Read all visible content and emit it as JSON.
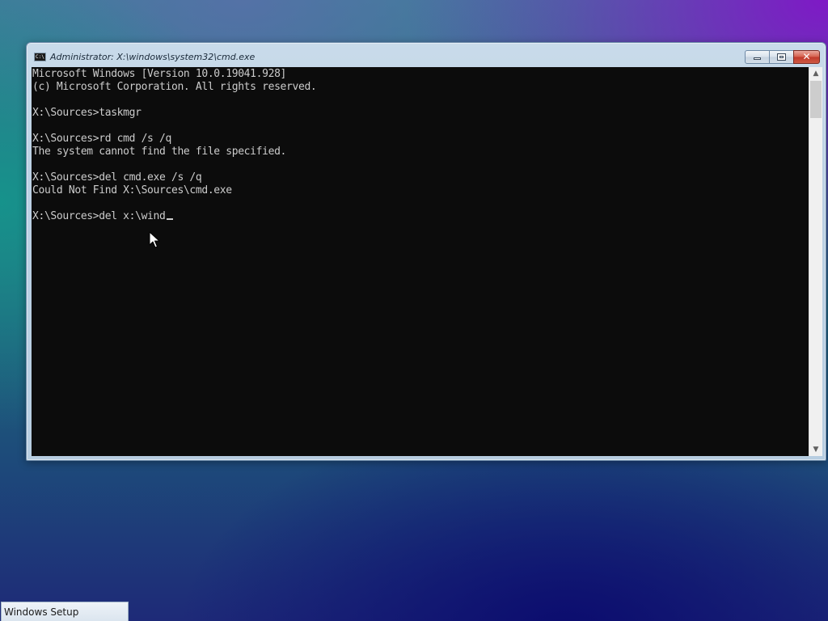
{
  "window": {
    "title": "Administrator: X:\\windows\\system32\\cmd.exe",
    "icon": "cmd-console-icon",
    "icon_label": "C:\\",
    "controls": {
      "minimize_icon": "minimize-icon",
      "maximize_icon": "restore-icon",
      "close_icon": "close-icon",
      "close_glyph": "✕"
    }
  },
  "console": {
    "lines": [
      "Microsoft Windows [Version 10.0.19041.928]",
      "(c) Microsoft Corporation. All rights reserved.",
      "",
      "X:\\Sources>taskmgr",
      "",
      "X:\\Sources>rd cmd /s /q",
      "The system cannot find the file specified.",
      "",
      "X:\\Sources>del cmd.exe /s /q",
      "Could Not Find X:\\Sources\\cmd.exe",
      "",
      "X:\\Sources>del x:\\wind"
    ],
    "colors": {
      "background": "#0c0c0c",
      "foreground": "#cccccc"
    }
  },
  "scrollbar": {
    "up_glyph": "▲",
    "down_glyph": "▼"
  },
  "taskbar": {
    "items": [
      {
        "label": "Windows Setup"
      }
    ]
  }
}
